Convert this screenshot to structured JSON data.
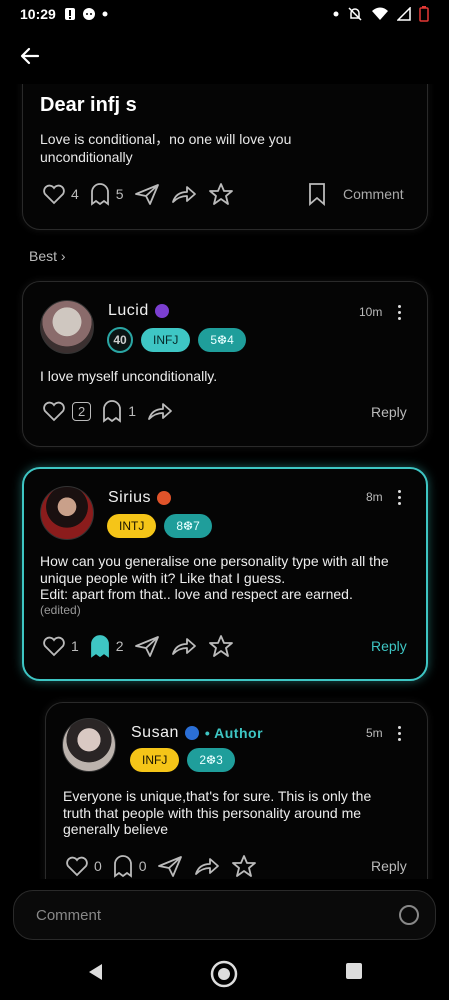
{
  "status": {
    "time": "10:29"
  },
  "post": {
    "title": "Dear infj s",
    "body": "Love is conditional，no one will love you unconditionally",
    "likes": "4",
    "ghosts": "5",
    "comment_label": "Comment"
  },
  "best_label": "Best ›",
  "comments": [
    {
      "name": "Lucid",
      "badge_color": "#7b3fd0",
      "time": "10m",
      "level": "40",
      "type": "INFJ",
      "enneagram": "5❆4",
      "text": "I love myself unconditionally.",
      "likes_box": "2",
      "ghosts": "1",
      "reply": "Reply"
    },
    {
      "name": "Sirius",
      "badge_color": "#e0532a",
      "time": "8m",
      "type": "INTJ",
      "enneagram": "8❆7",
      "text": "How can you generalise one personality type with all the unique people with it? Like that I guess.\nEdit: apart from that.. love and respect are earned.",
      "edited": "(edited)",
      "likes": "1",
      "ghosts": "2",
      "reply": "Reply"
    },
    {
      "name": "Susan",
      "badge_color": "#2b6fd6",
      "author": "• Author",
      "time": "5m",
      "type": "INFJ",
      "enneagram": "2❆3",
      "text": "Everyone is unique,that's for sure.  This is only the truth that people with this personality around me generally believe",
      "likes": "0",
      "ghosts": "0",
      "reply": "Reply"
    }
  ],
  "input": {
    "placeholder": "Comment"
  }
}
